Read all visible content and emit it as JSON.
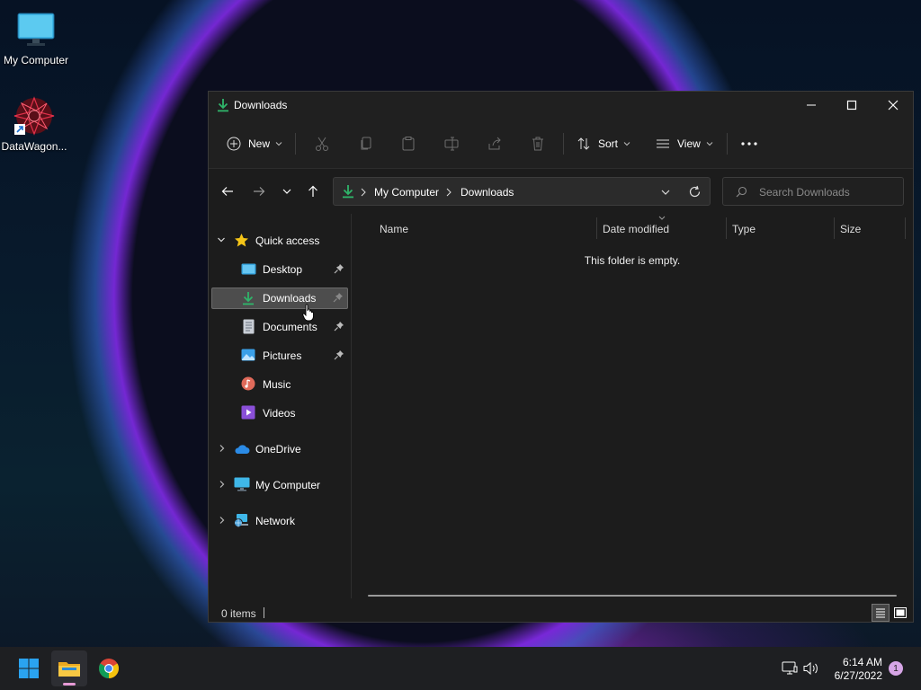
{
  "desktop": {
    "icons": [
      {
        "label": "My Computer",
        "icon": "monitor-icon"
      },
      {
        "label": "DataWagon...",
        "icon": "datawagon-shortcut-icon"
      }
    ]
  },
  "window": {
    "title": "Downloads",
    "controls": [
      "minimize",
      "maximize",
      "close"
    ]
  },
  "toolbar": {
    "new_label": "New",
    "sort_label": "Sort",
    "view_label": "View",
    "more_label": "See more"
  },
  "nav": {
    "address": [
      "My Computer",
      "Downloads"
    ],
    "search_placeholder": "Search Downloads"
  },
  "navpane": {
    "quick_access": "Quick access",
    "items": [
      {
        "label": "Desktop",
        "pinned": true
      },
      {
        "label": "Downloads",
        "pinned": true,
        "selected": true
      },
      {
        "label": "Documents",
        "pinned": true
      },
      {
        "label": "Pictures",
        "pinned": true
      },
      {
        "label": "Music",
        "pinned": false
      },
      {
        "label": "Videos",
        "pinned": false
      }
    ],
    "roots": [
      {
        "label": "OneDrive"
      },
      {
        "label": "My Computer"
      },
      {
        "label": "Network"
      }
    ]
  },
  "content": {
    "columns": [
      "Name",
      "Date modified",
      "Type",
      "Size"
    ],
    "empty_message": "This folder is empty."
  },
  "status": {
    "items_count": "0 items"
  },
  "taskbar": {
    "time": "6:14 AM",
    "date": "6/27/2022",
    "notification_count": "1"
  },
  "colors": {
    "accent_download": "#2fb56a",
    "selection": "#4d4d4d",
    "window_bg": "#1c1c1c"
  }
}
